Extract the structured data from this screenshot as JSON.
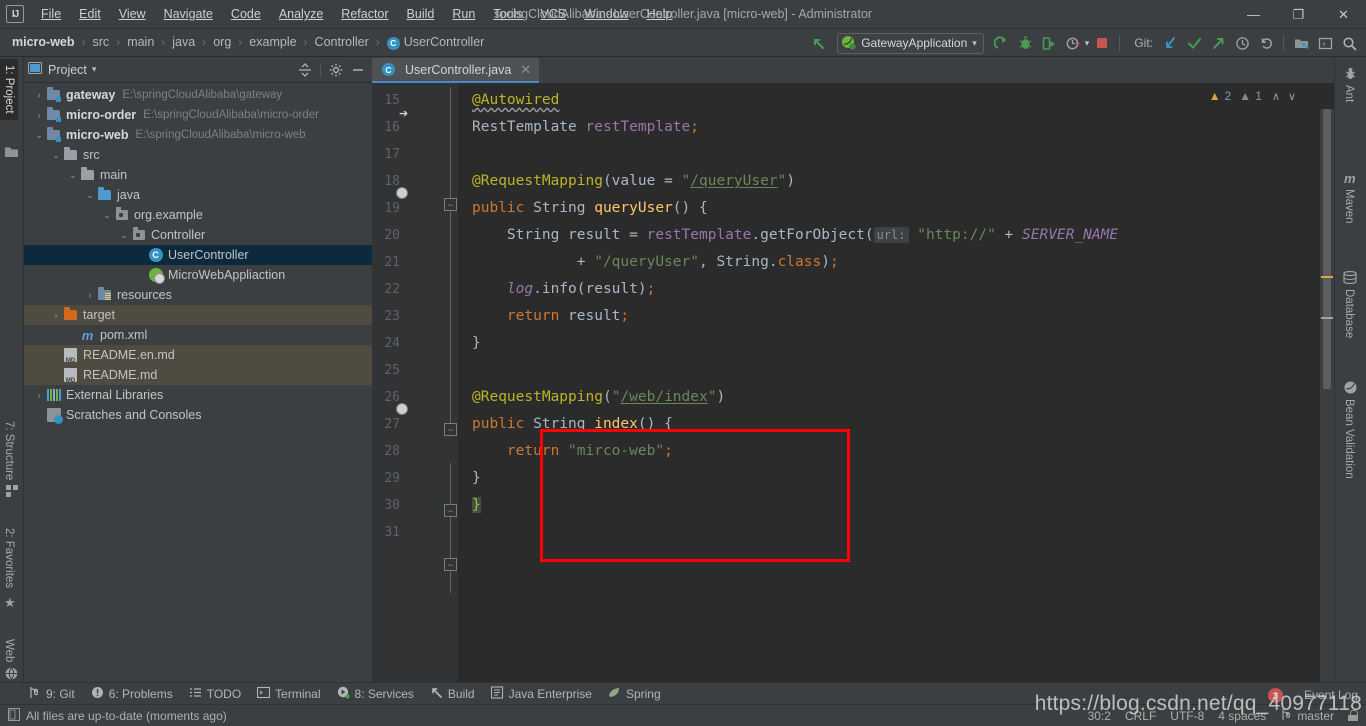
{
  "window": {
    "title": "springCloudAlibaba - UserController.java [micro-web] - Administrator",
    "minimize": "—",
    "restore": "❐",
    "close": "✕",
    "logo": "IJ"
  },
  "menubar": [
    {
      "label": "File"
    },
    {
      "label": "Edit"
    },
    {
      "label": "View"
    },
    {
      "label": "Navigate"
    },
    {
      "label": "Code"
    },
    {
      "label": "Analyze"
    },
    {
      "label": "Refactor"
    },
    {
      "label": "Build"
    },
    {
      "label": "Run"
    },
    {
      "label": "Tools"
    },
    {
      "label": "VCS"
    },
    {
      "label": "Window"
    },
    {
      "label": "Help"
    }
  ],
  "breadcrumb": [
    {
      "label": "micro-web",
      "bold": true
    },
    {
      "label": "src"
    },
    {
      "label": "main"
    },
    {
      "label": "java"
    },
    {
      "label": "org"
    },
    {
      "label": "example"
    },
    {
      "label": "Controller"
    },
    {
      "label": "UserController",
      "icon": "class-icon",
      "icon_char": "C"
    }
  ],
  "toolbar": {
    "back_icon": "back-arrow-icon",
    "run_config": "GatewayApplication",
    "run_config_caret": "▾",
    "run_icon": "run-icon",
    "debug_icon": "debug-icon",
    "run_with_coverage_icon": "run-coverage-icon",
    "profile_icon": "profile-icon",
    "stop_icon": "stop-icon",
    "git_label": "Git:",
    "update_icon": "update-project-icon",
    "commit_icon": "commit-icon",
    "push_icon": "push-icon",
    "history_icon": "history-icon",
    "revert_icon": "revert-icon",
    "structure_icon": "project-structure-icon",
    "terminal_icon": "terminal-icon",
    "search_icon": "search-everywhere-icon"
  },
  "left_strip": {
    "top": [
      {
        "label": "1: Project",
        "icon": "project-icon"
      }
    ],
    "bottom": [
      {
        "label": "7: Structure",
        "icon": "structure-icon"
      },
      {
        "label": "2: Favorites",
        "icon": "star-icon"
      },
      {
        "label": "Web",
        "icon": "web-icon"
      }
    ]
  },
  "right_strip": [
    {
      "label": "Ant",
      "icon": "ant-icon"
    },
    {
      "label": "Maven",
      "icon": "maven-icon"
    },
    {
      "label": "Database",
      "icon": "database-icon"
    },
    {
      "label": "Bean Validation",
      "icon": "bean-validation-icon"
    }
  ],
  "project_panel": {
    "title": "Project",
    "title_caret": "▾",
    "collapse_icon": "collapse-all-icon",
    "settings_icon": "gear-icon",
    "hide_icon": "hide-icon",
    "tree": [
      {
        "indent": 0,
        "twisty": "›",
        "icon": "module-folder",
        "label": "gateway",
        "bold": true,
        "path": "E:\\springCloudAlibaba\\gateway",
        "state": "normal"
      },
      {
        "indent": 0,
        "twisty": "›",
        "icon": "module-folder",
        "label": "micro-order",
        "bold": true,
        "path": "E:\\springCloudAlibaba\\micro-order",
        "state": "normal"
      },
      {
        "indent": 0,
        "twisty": "⌄",
        "icon": "module-folder",
        "label": "micro-web",
        "bold": true,
        "path": "E:\\springCloudAlibaba\\micro-web",
        "state": "normal"
      },
      {
        "indent": 1,
        "twisty": "⌄",
        "icon": "folder-gray",
        "label": "src",
        "path": "",
        "state": "normal"
      },
      {
        "indent": 2,
        "twisty": "⌄",
        "icon": "folder-gray",
        "label": "main",
        "path": "",
        "state": "normal"
      },
      {
        "indent": 3,
        "twisty": "⌄",
        "icon": "folder-blue",
        "label": "java",
        "path": "",
        "state": "normal"
      },
      {
        "indent": 4,
        "twisty": "⌄",
        "icon": "package",
        "label": "org.example",
        "path": "",
        "state": "normal"
      },
      {
        "indent": 5,
        "twisty": "⌄",
        "icon": "package",
        "label": "Controller",
        "path": "",
        "state": "normal"
      },
      {
        "indent": 6,
        "twisty": "",
        "icon": "class-icon",
        "label": "UserController",
        "path": "",
        "state": "selected"
      },
      {
        "indent": 6,
        "twisty": "",
        "icon": "spring-bean-icon",
        "label": "MicroWebAppliaction",
        "path": "",
        "state": "normal"
      },
      {
        "indent": 3,
        "twisty": "›",
        "icon": "folder-resources",
        "label": "resources",
        "path": "",
        "state": "normal"
      },
      {
        "indent": 1,
        "twisty": "›",
        "icon": "folder-orange",
        "label": "target",
        "path": "",
        "state": "highlight"
      },
      {
        "indent": 2,
        "twisty": "",
        "icon": "maven-file-icon",
        "label": "pom.xml",
        "path": "",
        "state": "normal"
      },
      {
        "indent": 1,
        "twisty": "",
        "icon": "markdown-icon",
        "label": "README.en.md",
        "path": "",
        "state": "highlight"
      },
      {
        "indent": 1,
        "twisty": "",
        "icon": "markdown-icon",
        "label": "README.md",
        "path": "",
        "state": "highlight"
      },
      {
        "indent": 0,
        "twisty": "›",
        "icon": "library-icon",
        "label": "External Libraries",
        "path": "",
        "state": "normal"
      },
      {
        "indent": 0,
        "twisty": "",
        "icon": "scratches-icon",
        "label": "Scratches and Consoles",
        "path": "",
        "state": "normal"
      }
    ]
  },
  "editor": {
    "tab": {
      "label": "UserController.java",
      "icon": "class-icon",
      "icon_char": "C",
      "close": "✕"
    },
    "inspections": {
      "warn_count": "2",
      "weak_count": "1",
      "up": "∧",
      "down": "∨",
      "warn_icon": "warning-triangle-icon",
      "weak_icon": "weak-warning-triangle-icon"
    },
    "first_line": 15,
    "lines": [
      15,
      16,
      17,
      18,
      19,
      20,
      21,
      22,
      23,
      24,
      25,
      26,
      27,
      28,
      29,
      30,
      31
    ],
    "code": [
      "@Autowired",
      "RestTemplate restTemplate;",
      "",
      "@RequestMapping(value = \"/queryUser\")",
      "public String queryUser() {",
      "    String result = restTemplate.getForObject( url: \"http://\" + SERVER_NAME",
      "            + \"/queryUser\", String.class);",
      "    log.info(result);",
      "    return result;",
      "}",
      "",
      "@RequestMapping(\"/web/index\")",
      "public String index() {",
      "    return \"mirco-web\";",
      "}",
      "}",
      ""
    ],
    "highlight_box_label": "highlighted-code-region"
  },
  "bottom_tools": [
    {
      "label": "9: Git",
      "underline": "9",
      "icon": "git-icon"
    },
    {
      "label": "6: Problems",
      "underline": "6",
      "icon": "problems-icon"
    },
    {
      "label": "TODO",
      "underline": "",
      "icon": "todo-icon"
    },
    {
      "label": "Terminal",
      "underline": "",
      "icon": "terminal-icon"
    },
    {
      "label": "8: Services",
      "underline": "8",
      "icon": "services-icon"
    },
    {
      "label": "Build",
      "underline": "",
      "icon": "build-hammer-icon"
    },
    {
      "label": "Java Enterprise",
      "underline": "",
      "icon": "java-enterprise-icon"
    },
    {
      "label": "Spring",
      "underline": "",
      "icon": "spring-leaf-icon"
    }
  ],
  "statusbar": {
    "message": "All files are up-to-date (moments ago)",
    "message_icon": "file-icon",
    "caret_position": "30:2",
    "line_separator": "CRLF",
    "encoding": "UTF-8",
    "indent": "4 spaces",
    "branch": "master",
    "branch_icon": "git-branch-icon",
    "lock_icon": "lock-icon",
    "event_log": "Event Log",
    "event_log_count": "3"
  },
  "watermark": "https://blog.csdn.net/qq_40977118",
  "colors": {
    "chrome": "#3c3f41",
    "editor_bg": "#2b2b2b",
    "gutter_bg": "#313335",
    "accent_blue": "#3592c4",
    "selection": "#0d293e",
    "highlight_row": "#4f4b41",
    "red_box": "#fe0000",
    "spring_green": "#6db33f",
    "keyword": "#cc7832",
    "annotation": "#bbb529",
    "string": "#6a8759",
    "field": "#9876aa",
    "method": "#ffc66d",
    "text": "#a9b7c6",
    "tab_underline": "#4a88c7"
  }
}
